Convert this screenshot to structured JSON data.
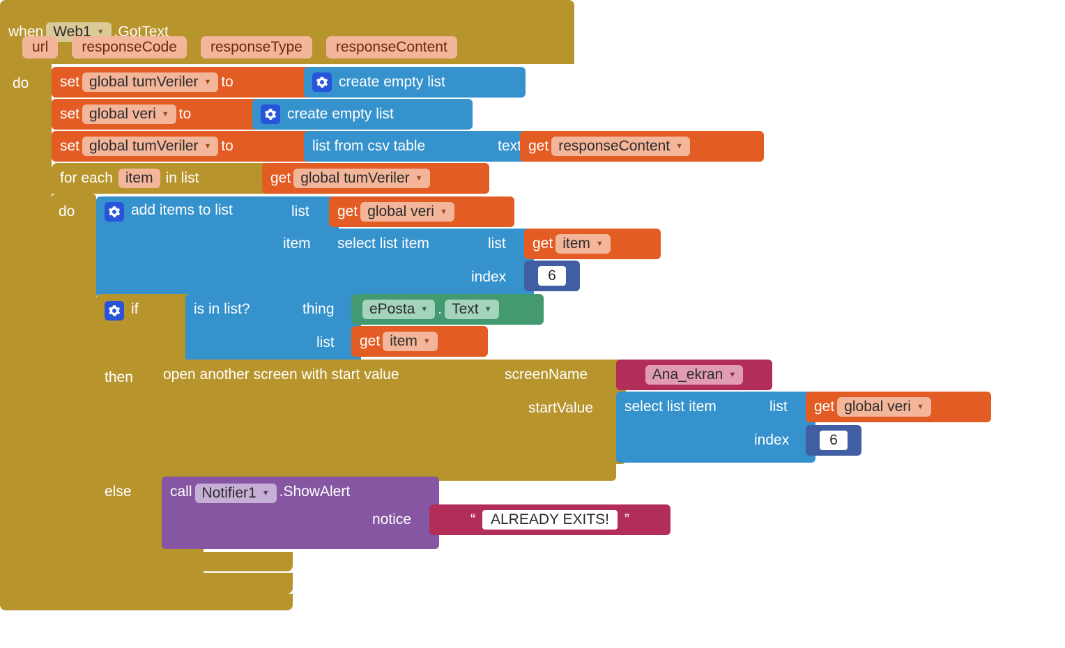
{
  "event": {
    "when": "when",
    "component": "Web1",
    "event_name": ".GotText",
    "params": [
      "url",
      "responseCode",
      "responseType",
      "responseContent"
    ],
    "do": "do"
  },
  "set1": {
    "set": "set",
    "var": "global tumVeriler",
    "to": "to"
  },
  "emptylist": {
    "label": "create empty list"
  },
  "set2": {
    "set": "set",
    "var": "global veri",
    "to": "to"
  },
  "set3": {
    "set": "set",
    "var": "global tumVeriler",
    "to": "to"
  },
  "csv": {
    "label": "list from csv table",
    "arg": "text"
  },
  "get_rc": {
    "get": "get",
    "var": "responseContent"
  },
  "foreach": {
    "label": "for each",
    "item": "item",
    "inlist": "in list",
    "do": "do"
  },
  "get_tv": {
    "get": "get",
    "var": "global tumVeriler"
  },
  "additems": {
    "label": "add items to list",
    "arg_list": "list",
    "arg_item": "item"
  },
  "get_veri": {
    "get": "get",
    "var": "global veri"
  },
  "sli": {
    "label": "select list item",
    "arg_list": "list",
    "arg_index": "index",
    "index_val": "6"
  },
  "get_item": {
    "get": "get",
    "var": "item"
  },
  "ifblk": {
    "if": "if",
    "then": "then",
    "else": "else"
  },
  "isin": {
    "label": "is in list?",
    "arg_thing": "thing",
    "arg_list": "list"
  },
  "eposta": {
    "comp": "ePosta",
    "dot": ".",
    "prop": "Text"
  },
  "get_item2": {
    "get": "get",
    "var": "item"
  },
  "open": {
    "label": "open another screen with start value",
    "arg_screen": "screenName",
    "arg_start": "startValue",
    "screen": "Ana_ekran"
  },
  "sli2": {
    "label": "select list item",
    "arg_list": "list",
    "arg_index": "index",
    "index_val": "6"
  },
  "get_veri2": {
    "get": "get",
    "var": "global veri"
  },
  "call": {
    "call": "call",
    "comp": "Notifier1",
    "method": ".ShowAlert",
    "arg": "notice"
  },
  "str": {
    "open": "“",
    "val": "ALREADY EXITS!",
    "close": "”"
  }
}
